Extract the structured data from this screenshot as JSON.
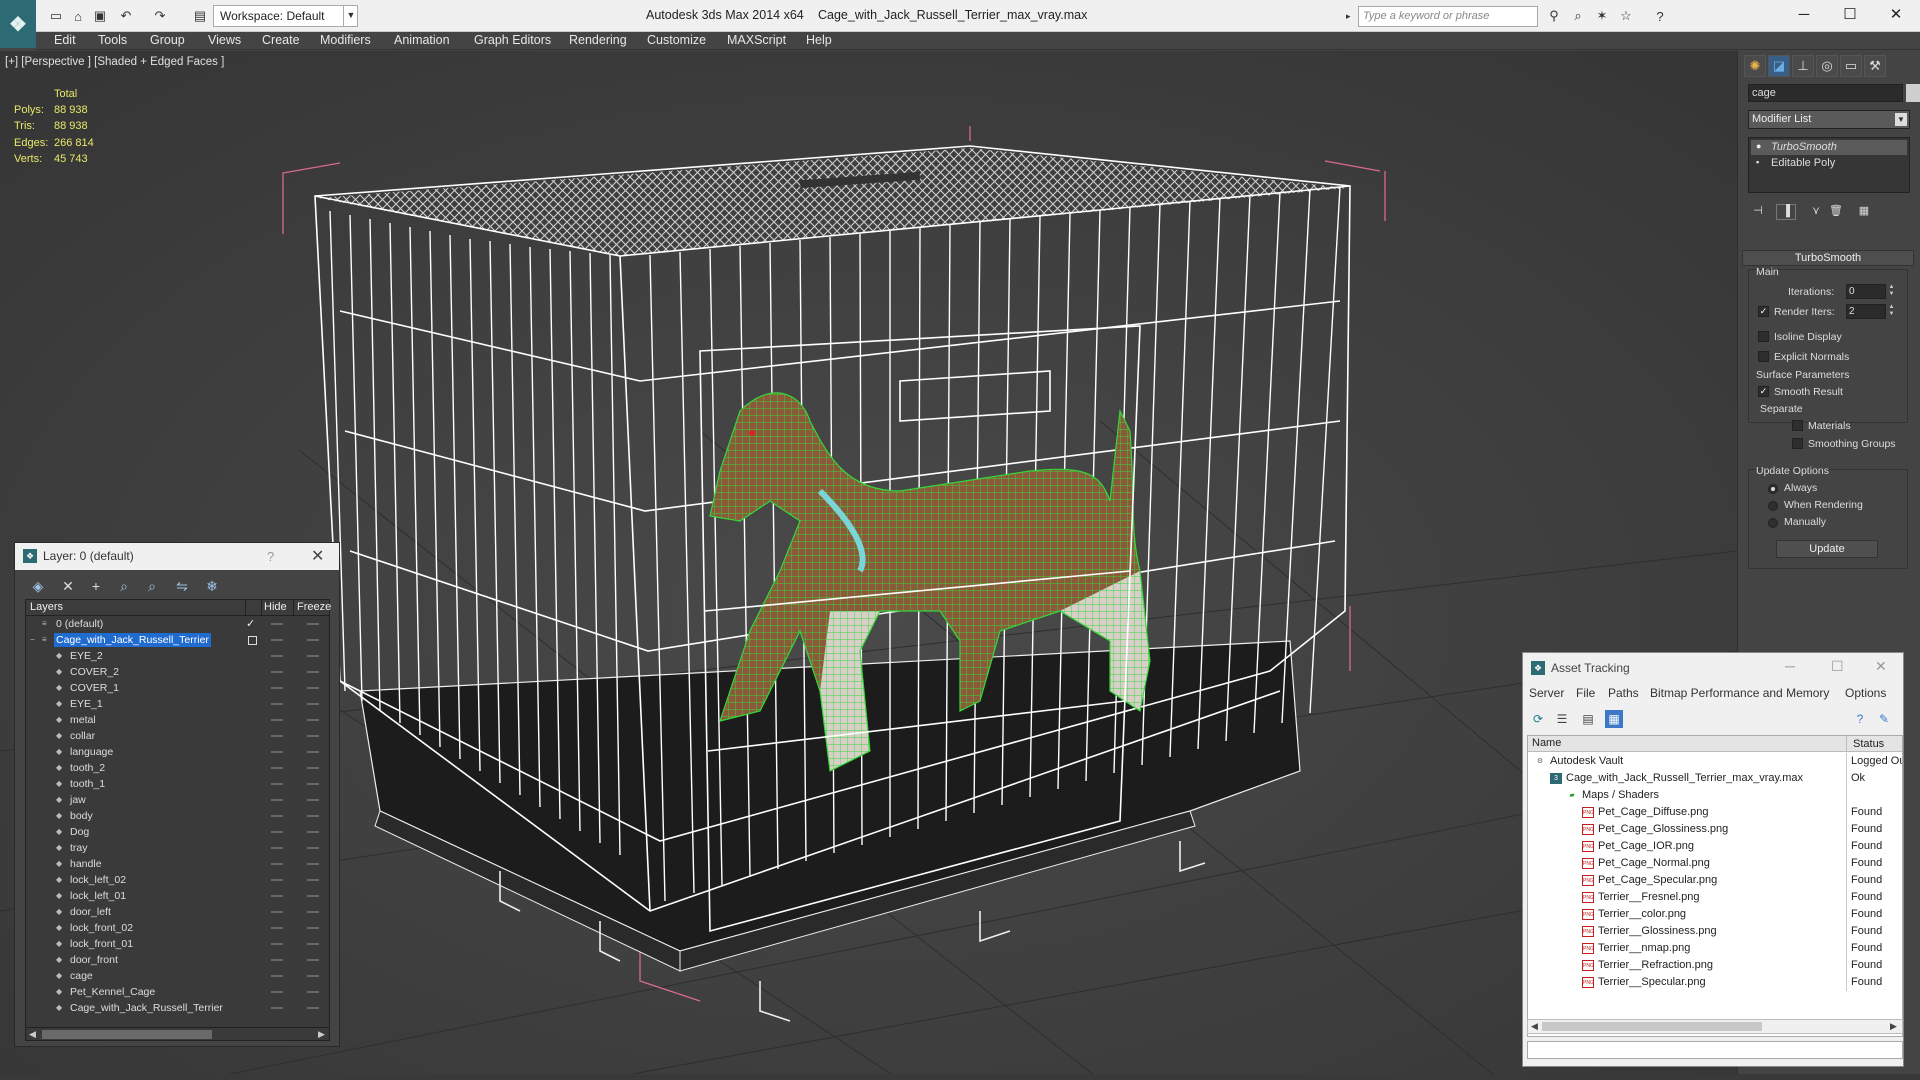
{
  "titlebar": {
    "workspace": "Workspace: Default",
    "app_title": "Autodesk 3ds Max  2014 x64",
    "file_title": "Cage_with_Jack_Russell_Terrier_max_vray.max",
    "search_placeholder": "Type a keyword or phrase"
  },
  "menu": [
    "Edit",
    "Tools",
    "Group",
    "Views",
    "Create",
    "Modifiers",
    "Animation",
    "Graph Editors",
    "Rendering",
    "Customize",
    "MAXScript",
    "Help"
  ],
  "viewport": {
    "label": "[+] [Perspective ] [Shaded + Edged Faces ]",
    "stats": {
      "header": "Total",
      "rows": [
        {
          "label": "Polys:",
          "value": "88 938"
        },
        {
          "label": "Tris:",
          "value": "88 938"
        },
        {
          "label": "Edges:",
          "value": "266 814"
        },
        {
          "label": "Verts:",
          "value": "45 743"
        }
      ]
    }
  },
  "command_panel": {
    "object_name": "cage",
    "modifier_list": "Modifier List",
    "stack": [
      "TurboSmooth",
      "Editable Poly"
    ],
    "rollout_title": "TurboSmooth",
    "main_label": "Main",
    "iterations_label": "Iterations:",
    "iterations_value": "0",
    "render_iters_label": "Render Iters:",
    "render_iters_value": "2",
    "isoline_display": "Isoline Display",
    "explicit_normals": "Explicit Normals",
    "surface_parameters": "Surface Parameters",
    "smooth_result": "Smooth Result",
    "separate": "Separate",
    "materials": "Materials",
    "smoothing_groups": "Smoothing Groups",
    "update_options": "Update Options",
    "always": "Always",
    "when_rendering": "When Rendering",
    "manually": "Manually",
    "update_button": "Update"
  },
  "layer_dialog": {
    "title": "Layer: 0 (default)",
    "help": "?",
    "col_layers": "Layers",
    "col_hide": "Hide",
    "col_freeze": "Freeze",
    "rows": [
      {
        "name": "0 (default)",
        "level": 0,
        "checked": true
      },
      {
        "name": "Cage_with_Jack_Russell_Terrier",
        "level": 0,
        "selected": true
      },
      {
        "name": "EYE_2",
        "level": 1
      },
      {
        "name": "COVER_2",
        "level": 1
      },
      {
        "name": "COVER_1",
        "level": 1
      },
      {
        "name": "EYE_1",
        "level": 1
      },
      {
        "name": "metal",
        "level": 1
      },
      {
        "name": "collar",
        "level": 1
      },
      {
        "name": "language",
        "level": 1
      },
      {
        "name": "tooth_2",
        "level": 1
      },
      {
        "name": "tooth_1",
        "level": 1
      },
      {
        "name": "jaw",
        "level": 1
      },
      {
        "name": "body",
        "level": 1
      },
      {
        "name": "Dog",
        "level": 1
      },
      {
        "name": "tray",
        "level": 1
      },
      {
        "name": "handle",
        "level": 1
      },
      {
        "name": "lock_left_02",
        "level": 1
      },
      {
        "name": "lock_left_01",
        "level": 1
      },
      {
        "name": "door_left",
        "level": 1
      },
      {
        "name": "lock_front_02",
        "level": 1
      },
      {
        "name": "lock_front_01",
        "level": 1
      },
      {
        "name": "door_front",
        "level": 1
      },
      {
        "name": "cage",
        "level": 1
      },
      {
        "name": "Pet_Kennel_Cage",
        "level": 1
      },
      {
        "name": "Cage_with_Jack_Russell_Terrier",
        "level": 1
      }
    ]
  },
  "asset_tracking": {
    "title": "Asset Tracking",
    "menu": [
      "Server",
      "File",
      "Paths",
      "Bitmap Performance and Memory",
      "Options"
    ],
    "col_name": "Name",
    "col_status": "Status",
    "rows": [
      {
        "name": "Autodesk Vault",
        "status": "Logged Out",
        "level": 0,
        "icon": "vault"
      },
      {
        "name": "Cage_with_Jack_Russell_Terrier_max_vray.max",
        "status": "Ok",
        "level": 1,
        "icon": "max"
      },
      {
        "name": "Maps / Shaders",
        "status": "",
        "level": 2,
        "icon": "folder"
      },
      {
        "name": "Pet_Cage_Diffuse.png",
        "status": "Found",
        "level": 3,
        "icon": "png"
      },
      {
        "name": "Pet_Cage_Glossiness.png",
        "status": "Found",
        "level": 3,
        "icon": "png"
      },
      {
        "name": "Pet_Cage_IOR.png",
        "status": "Found",
        "level": 3,
        "icon": "png"
      },
      {
        "name": "Pet_Cage_Normal.png",
        "status": "Found",
        "level": 3,
        "icon": "png"
      },
      {
        "name": "Pet_Cage_Specular.png",
        "status": "Found",
        "level": 3,
        "icon": "png"
      },
      {
        "name": "Terrier__Fresnel.png",
        "status": "Found",
        "level": 3,
        "icon": "png"
      },
      {
        "name": "Terrier__color.png",
        "status": "Found",
        "level": 3,
        "icon": "png"
      },
      {
        "name": "Terrier__Glossiness.png",
        "status": "Found",
        "level": 3,
        "icon": "png"
      },
      {
        "name": "Terrier__nmap.png",
        "status": "Found",
        "level": 3,
        "icon": "png"
      },
      {
        "name": "Terrier__Refraction.png",
        "status": "Found",
        "level": 3,
        "icon": "png"
      },
      {
        "name": "Terrier__Specular.png",
        "status": "Found",
        "level": 3,
        "icon": "png"
      }
    ]
  },
  "colors": {
    "stats_text": "#e9e96a",
    "wireframe": "#ffffff",
    "dog_wire": "#39d13a",
    "bbox": "#d86a8e",
    "selection": "#1f6bd0"
  }
}
